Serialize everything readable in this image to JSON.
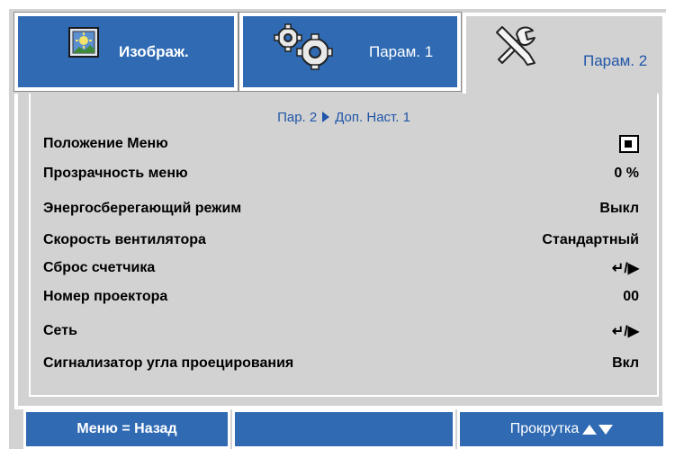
{
  "tabs": [
    {
      "label": "Изображ.",
      "icon": "image-icon",
      "active": false
    },
    {
      "label": "Парам. 1",
      "icon": "gears-icon",
      "active": false
    },
    {
      "label": "Парам. 2",
      "icon": "tools-icon",
      "active": true
    }
  ],
  "breadcrumb": {
    "parent": "Пар. 2",
    "current": "Доп. Наст. 1"
  },
  "rows": [
    {
      "label": "Положение Меню",
      "value": "",
      "value_icon": "menu-position-icon"
    },
    {
      "label": "Прозрачность меню",
      "value": "0 %"
    },
    {
      "label": "Энергосберегающий режим",
      "value": "Выкл"
    },
    {
      "label": "Скорость вентилятора",
      "value": "Стандартный"
    },
    {
      "label": "Сброс счетчика",
      "value": "↵/▶"
    },
    {
      "label": "Номер проектора",
      "value": "00"
    },
    {
      "label": "Сеть",
      "value": "↵/▶"
    },
    {
      "label": "Сигнализатор угла проецирования",
      "value": "Вкл"
    }
  ],
  "footer": {
    "back": "Меню = Назад",
    "middle": "",
    "scroll": "Прокрутка"
  },
  "colors": {
    "accent": "#2f6ab3",
    "panel": "#d2d2d2",
    "breadcrumb": "#1f56a8"
  }
}
